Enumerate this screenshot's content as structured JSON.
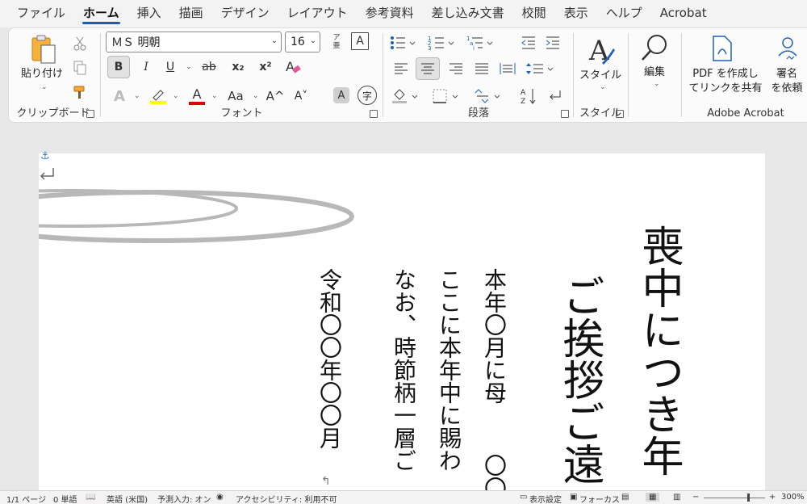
{
  "menu": {
    "tabs": [
      "ファイル",
      "ホーム",
      "挿入",
      "描画",
      "デザイン",
      "レイアウト",
      "参考資料",
      "差し込み文書",
      "校閲",
      "表示",
      "ヘルプ",
      "Acrobat"
    ],
    "active": "ホーム"
  },
  "ribbon": {
    "clipboard": {
      "paste_label": "貼り付け",
      "group_label": "クリップボード"
    },
    "font": {
      "font_name": "ＭＳ 明朝",
      "font_size": "16",
      "group_label": "フォント",
      "bold": "B",
      "italic": "I",
      "underline": "U",
      "strike": "ab",
      "subscript": "x₂",
      "superscript": "x²",
      "case": "Aa",
      "grow": "A^",
      "shrink": "A˅",
      "ruby_top": "ア",
      "ruby_bottom": "亜",
      "shading_char": "A",
      "enclose_char": "字",
      "highlight_color": "#ffff00",
      "font_color": "#e00000"
    },
    "paragraph": {
      "group_label": "段落"
    },
    "styles": {
      "label": "スタイル",
      "group_label": "スタイル"
    },
    "editing": {
      "label": "編集"
    },
    "acrobat": {
      "pdf_label_1": "PDF を作成し",
      "pdf_label_2": "てリンクを共有",
      "sign_label_1": "署名",
      "sign_label_2": "を依頼",
      "group_label": "Adobe Acrobat"
    }
  },
  "document": {
    "title": "喪中につき年",
    "subtitle": "ご挨拶ご遠",
    "line1_top": "本年〇月に母",
    "line1_bottom": "〇〇",
    "line2": "ここに本年中に賜わ",
    "line3": "なお、時節柄一層ご",
    "date": "令和〇〇年〇〇月"
  },
  "status": {
    "page": "1/1 ページ",
    "words": "0 単語",
    "language": "英語 (米国)",
    "predict": "予測入力: オン",
    "accessibility": "アクセシビリティ: 利用不可",
    "display_settings": "表示設定",
    "focus": "フォーカス",
    "zoom": "300%"
  }
}
